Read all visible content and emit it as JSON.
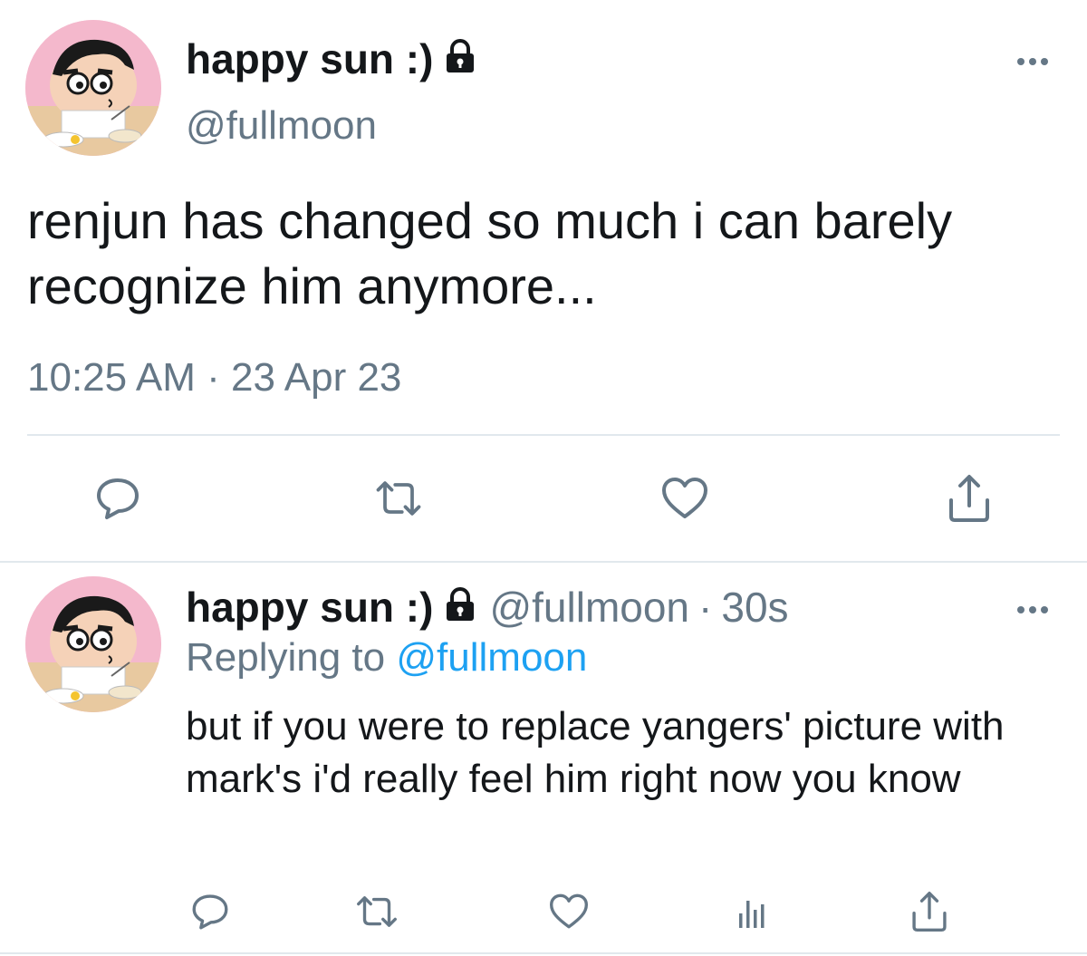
{
  "main_tweet": {
    "display_name": "happy sun :)",
    "handle": "@fullmoon",
    "text": "renjun has changed so much i can barely recognize him anymore...",
    "timestamp": "10:25 AM · 23 Apr 23",
    "protected": true
  },
  "reply_tweet": {
    "display_name": "happy sun :)",
    "handle": "@fullmoon",
    "separator": "·",
    "time_ago": "30s",
    "replying_prefix": "Replying to",
    "replying_handle": "@fullmoon",
    "text": "but if you were to replace yangers' picture with mark's i'd really feel him right now you know",
    "protected": true
  },
  "icons": {
    "main_actions": [
      "reply-icon",
      "retweet-icon",
      "like-icon",
      "share-icon"
    ],
    "reply_actions": [
      "reply-icon",
      "retweet-icon",
      "like-icon",
      "analytics-icon",
      "share-icon"
    ],
    "more": "more-icon",
    "lock": "lock-icon"
  },
  "colors": {
    "text": "#14171a",
    "secondary": "#657786",
    "link": "#1da1f2",
    "divider": "#e1e8ed",
    "icon": "#657786"
  }
}
